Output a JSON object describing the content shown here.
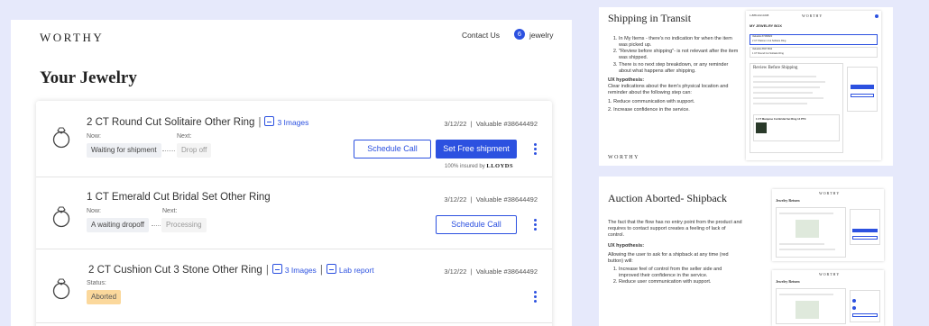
{
  "app": {
    "logo": "WORTHY",
    "contact": "Contact Us",
    "badge_count": "6",
    "jewelry_link": "jewelry",
    "page_title": "Your Jewelry"
  },
  "items": [
    {
      "title": "2 CT Round Cut Solitaire Other Ring",
      "images_link": "3 Images",
      "date": "3/12/22",
      "valuable": "Valuable #38644492",
      "now_label": "Now:",
      "next_label": "Next:",
      "now_value": "Waiting for shipment",
      "next_value": "Drop off",
      "schedule_button": "Schedule  Call",
      "shipment_button": "Set Free shipment",
      "insured_text": "100% insured by",
      "insured_brand": "LLOYDS"
    },
    {
      "title": "1 CT Emerald Cut Bridal Set Other Ring",
      "date": "3/12/22",
      "valuable": "Valuable #38644492",
      "now_label": "Now:",
      "next_label": "Next:",
      "now_value": "A waiting dropoff",
      "next_value": "Processing",
      "schedule_button": "Schedule  Call"
    },
    {
      "title": "2 CT Cushion Cut 3 Stone Other Ring",
      "images_link": "3 Images",
      "lab_link": "Lab report",
      "date": "3/12/22",
      "valuable": "Valuable #38644492",
      "status_label": "Status:",
      "status_value": "Aborted"
    }
  ],
  "slides": [
    {
      "title": "Shipping in Transit",
      "points": [
        "In My Items - there's no indication for when the item was picked up.",
        "\"Review before shipping\"- is not relevant after the item was shipped.",
        "There is no next step breakdown, or any reminder about what happens after shipping."
      ],
      "hypothesis_heading": "UX hypothesis:",
      "hypothesis_text": "Clear indications about the item's physical location and reminder about the following step can:",
      "outcomes": [
        "1. Reduce communication with support.",
        "2. Increase confidence in the service."
      ],
      "logo": "WORTHY",
      "mock": {
        "phone": "1-888-222-0208",
        "logo": "WORTHY",
        "heading": "MY JEWELRY BOX",
        "row1": "Valuable #7468920",
        "row1_sub": "2 CT Platinum Cut Solitaire Ring",
        "row2": "Valuable #8471842",
        "row2_sub": "1 CT Round Cut Solitaire Ring",
        "review_title": "Review Before Shipping",
        "item_name": "1 CT Marquise Cut Bridal Set Ring 14 PTtt"
      }
    },
    {
      "title": "Auction Aborted- Shipback",
      "intro": "The fact that the flow has no entry point from the product and requires to contact support creates a feeling of lack of control.",
      "hypothesis_heading": "UX hypothesis:",
      "hypothesis_text": "Allowing the user to ask for a shipback at any time (red button) will:",
      "points": [
        "Increase feel of control from the seller side and improved their confidence in the service.",
        "Reduce user communication with support."
      ],
      "mock": {
        "logo": "WORTHY",
        "heading": "Jewelry Return"
      }
    }
  ]
}
